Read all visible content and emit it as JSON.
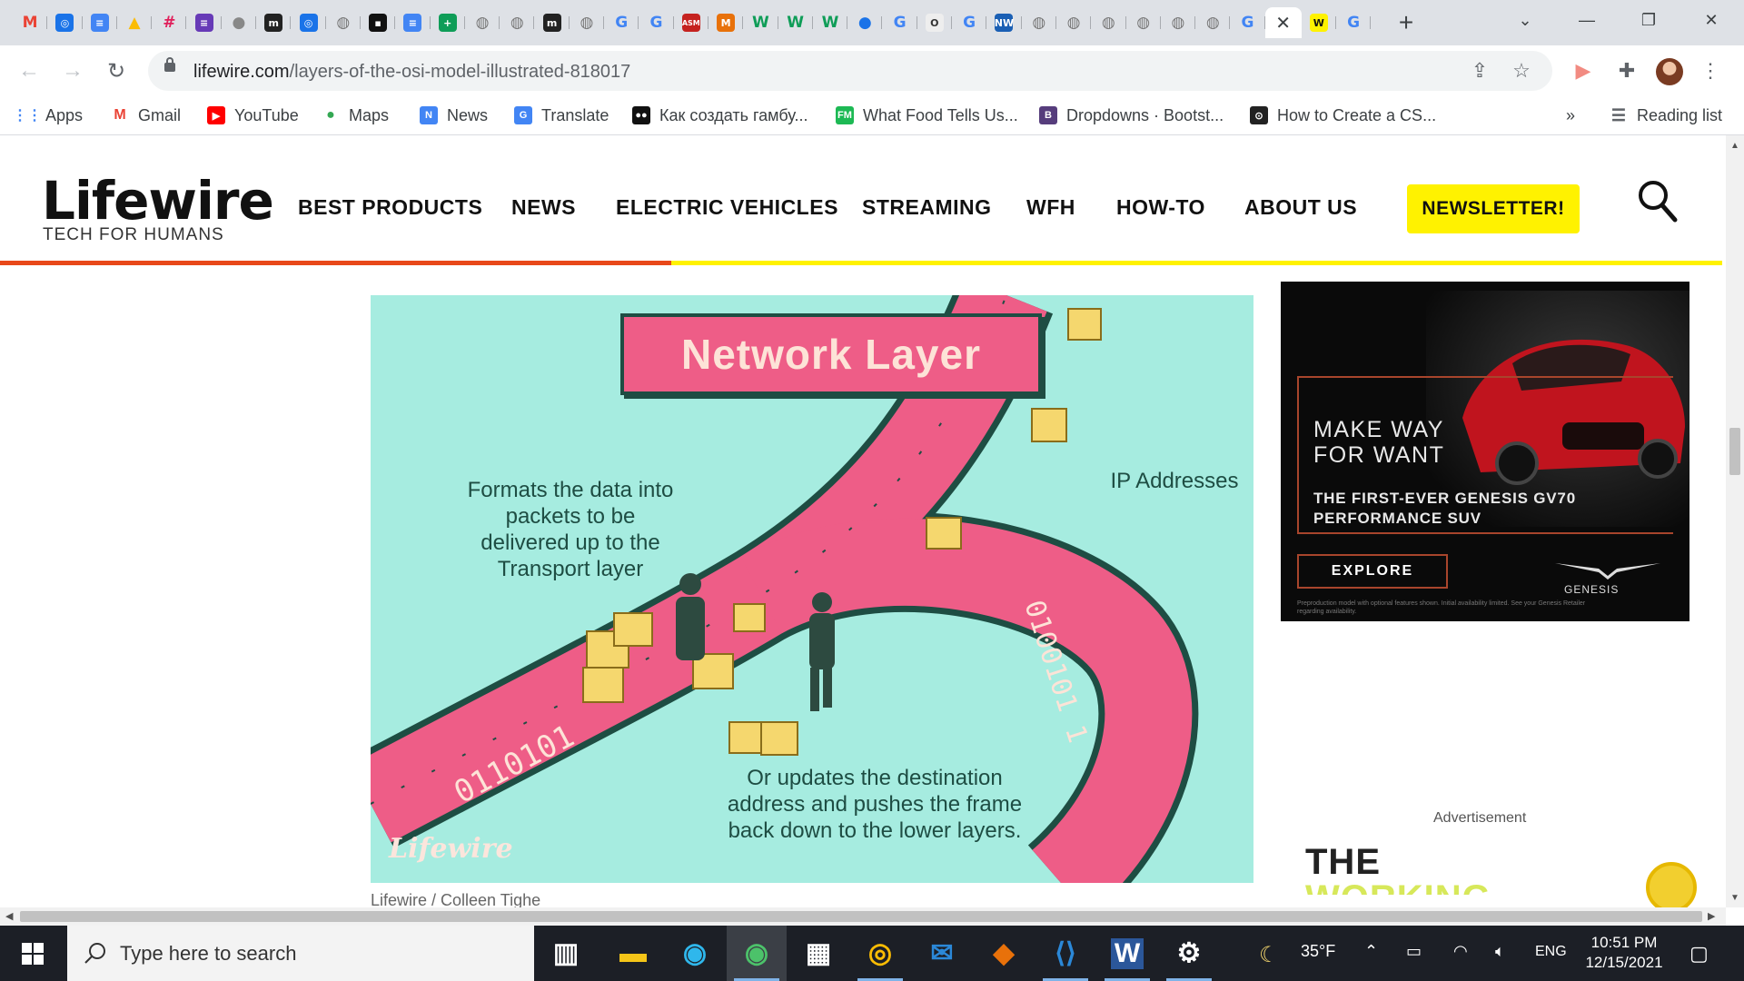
{
  "browser": {
    "tabs": [
      {
        "icon": "gmail-icon",
        "glyph": "M",
        "color": "#ea4335",
        "bg": "transparent"
      },
      {
        "icon": "grammarly-icon",
        "glyph": "◎",
        "color": "#fff",
        "bg": "#1a73e8"
      },
      {
        "icon": "google-docs-icon",
        "glyph": "≡",
        "color": "#fff",
        "bg": "#4285f4"
      },
      {
        "icon": "google-drive-icon",
        "glyph": "▲",
        "color": "#fbbc04",
        "bg": "transparent"
      },
      {
        "icon": "slack-icon",
        "glyph": "#",
        "color": "#e01e5a",
        "bg": "transparent"
      },
      {
        "icon": "google-forms-icon",
        "glyph": "≡",
        "color": "#fff",
        "bg": "#673ab7"
      },
      {
        "icon": "apple-icon",
        "glyph": "●",
        "color": "#888",
        "bg": "transparent"
      },
      {
        "icon": "medium-icon",
        "glyph": "m",
        "color": "#fff",
        "bg": "#222"
      },
      {
        "icon": "grammarly-icon",
        "glyph": "◎",
        "color": "#fff",
        "bg": "#1a73e8"
      },
      {
        "icon": "globe-icon",
        "glyph": "◍",
        "color": "#777",
        "bg": "transparent"
      },
      {
        "icon": "notion-icon",
        "glyph": "▪",
        "color": "#fff",
        "bg": "#111"
      },
      {
        "icon": "google-docs-icon",
        "glyph": "≡",
        "color": "#fff",
        "bg": "#4285f4"
      },
      {
        "icon": "google-sheets-icon",
        "glyph": "+",
        "color": "#fff",
        "bg": "#0f9d58"
      },
      {
        "icon": "globe-icon",
        "glyph": "◍",
        "color": "#777",
        "bg": "transparent"
      },
      {
        "icon": "globe-icon",
        "glyph": "◍",
        "color": "#777",
        "bg": "transparent"
      },
      {
        "icon": "medium-icon",
        "glyph": "m",
        "color": "#fff",
        "bg": "#222"
      },
      {
        "icon": "globe-icon",
        "glyph": "◍",
        "color": "#777",
        "bg": "transparent"
      },
      {
        "icon": "google-icon",
        "glyph": "G",
        "color": "#4285f4",
        "bg": "transparent"
      },
      {
        "icon": "google-icon",
        "glyph": "G",
        "color": "#4285f4",
        "bg": "transparent"
      },
      {
        "icon": "asm-icon",
        "glyph": "ASM",
        "color": "#fff",
        "bg": "#c5221f"
      },
      {
        "icon": "mix-icon",
        "glyph": "M",
        "color": "#fff",
        "bg": "#e8710a"
      },
      {
        "icon": "wordstat-icon",
        "glyph": "W",
        "color": "#0f9d58",
        "bg": "transparent"
      },
      {
        "icon": "wordstat-icon",
        "glyph": "W",
        "color": "#0f9d58",
        "bg": "transparent"
      },
      {
        "icon": "wordstat-icon",
        "glyph": "W",
        "color": "#0f9d58",
        "bg": "transparent"
      },
      {
        "icon": "blue-dot-icon",
        "glyph": "●",
        "color": "#1a73e8",
        "bg": "transparent"
      },
      {
        "icon": "google-icon",
        "glyph": "G",
        "color": "#4285f4",
        "bg": "transparent"
      },
      {
        "icon": "ring-icon",
        "glyph": "O",
        "color": "#333",
        "bg": "#eee"
      },
      {
        "icon": "google-icon",
        "glyph": "G",
        "color": "#4285f4",
        "bg": "transparent"
      },
      {
        "icon": "nw-icon",
        "glyph": "NW",
        "color": "#fff",
        "bg": "#1a5fb4"
      },
      {
        "icon": "globe-icon",
        "glyph": "◍",
        "color": "#777",
        "bg": "transparent"
      },
      {
        "icon": "globe-icon",
        "glyph": "◍",
        "color": "#777",
        "bg": "transparent"
      },
      {
        "icon": "globe-icon",
        "glyph": "◍",
        "color": "#777",
        "bg": "transparent"
      },
      {
        "icon": "globe-icon",
        "glyph": "◍",
        "color": "#777",
        "bg": "transparent"
      },
      {
        "icon": "globe-icon",
        "glyph": "◍",
        "color": "#777",
        "bg": "transparent"
      },
      {
        "icon": "globe-icon",
        "glyph": "◍",
        "color": "#777",
        "bg": "transparent"
      },
      {
        "icon": "google-icon",
        "glyph": "G",
        "color": "#4285f4",
        "bg": "transparent"
      },
      {
        "icon": "close-icon",
        "glyph": "✕",
        "color": "#3c4043",
        "bg": "transparent",
        "active": true
      },
      {
        "icon": "lifewire-icon",
        "glyph": "W",
        "color": "#111",
        "bg": "#fff200"
      },
      {
        "icon": "google-icon",
        "glyph": "G",
        "color": "#4285f4",
        "bg": "transparent"
      }
    ],
    "new_tab": "+",
    "url_host": "lifewire.com",
    "url_path": "/layers-of-the-osi-model-illustrated-818017",
    "bookmarks": [
      {
        "label": "Apps",
        "icon": "apps-grid-icon",
        "glyph": "⋮⋮",
        "color": "#4285f4",
        "bg": "transparent"
      },
      {
        "label": "Gmail",
        "icon": "gmail-icon",
        "glyph": "M",
        "color": "#ea4335",
        "bg": "transparent"
      },
      {
        "label": "YouTube",
        "icon": "youtube-icon",
        "glyph": "▶",
        "color": "#fff",
        "bg": "#ff0000"
      },
      {
        "label": "Maps",
        "icon": "maps-pin-icon",
        "glyph": "●",
        "color": "#34a853",
        "bg": "transparent"
      },
      {
        "label": "News",
        "icon": "google-news-icon",
        "glyph": "N",
        "color": "#fff",
        "bg": "#4285f4"
      },
      {
        "label": "Translate",
        "icon": "google-translate-icon",
        "glyph": "G",
        "color": "#fff",
        "bg": "#4285f4"
      },
      {
        "label": "Как создать гамбу...",
        "icon": "medium-icon",
        "glyph": "●●",
        "color": "#fff",
        "bg": "#111"
      },
      {
        "label": "What Food Tells Us...",
        "icon": "fm-icon",
        "glyph": "FM",
        "color": "#fff",
        "bg": "#1db954"
      },
      {
        "label": "Dropdowns · Bootst...",
        "icon": "bootstrap-icon",
        "glyph": "B",
        "color": "#fff",
        "bg": "#563d7c"
      },
      {
        "label": "How to Create a CS...",
        "icon": "codepen-icon",
        "glyph": "⊙",
        "color": "#fff",
        "bg": "#222"
      }
    ],
    "bookmarks_overflow": "»",
    "reading_list": "Reading list"
  },
  "site": {
    "logo": "Lifewire",
    "tagline": "TECH FOR HUMANS",
    "nav": [
      "BEST PRODUCTS",
      "NEWS",
      "ELECTRIC VEHICLES",
      "STREAMING",
      "WFH",
      "HOW-TO",
      "ABOUT US"
    ],
    "newsletter": "NEWSLETTER!",
    "read_progress": 0.39,
    "accent": "#e8481a",
    "highlight": "#fff200"
  },
  "article": {
    "image": {
      "title": "Network Layer",
      "left_text": "Formats the data into packets to be delivered up to the Transport layer",
      "right_text": "IP Addresses",
      "bottom_text": "Or updates the destination address and pushes the frame back down to the lower layers.",
      "binary_left": "0110101",
      "binary_right": "0100101 1",
      "watermark": "Lifewire"
    },
    "caption": "Lifewire / Colleen Tighe"
  },
  "ad": {
    "headline": "MAKE WAY FOR WANT",
    "subheadline": "THE FIRST-EVER GENESIS GV70 PERFORMANCE SUV",
    "cta": "EXPLORE",
    "brand": "GENESIS",
    "fine_print": "Preproduction model with optional features shown. Initial availability limited. See your Genesis Retailer regarding availability.",
    "label": "Advertisement",
    "second_ad_title": "THE",
    "second_ad_sub": "WORKING"
  },
  "taskbar": {
    "search_placeholder": "Type here to search",
    "apps": [
      "task-view-icon",
      "file-explorer-icon",
      "edge-icon",
      "edge-dev-icon",
      "microsoft-store-icon",
      "chrome-icon",
      "mail-icon",
      "git-icon",
      "vscode-icon",
      "word-icon",
      "settings-icon"
    ],
    "weather": "35°F",
    "language": "ENG",
    "time": "10:51 PM",
    "date": "12/15/2021"
  }
}
